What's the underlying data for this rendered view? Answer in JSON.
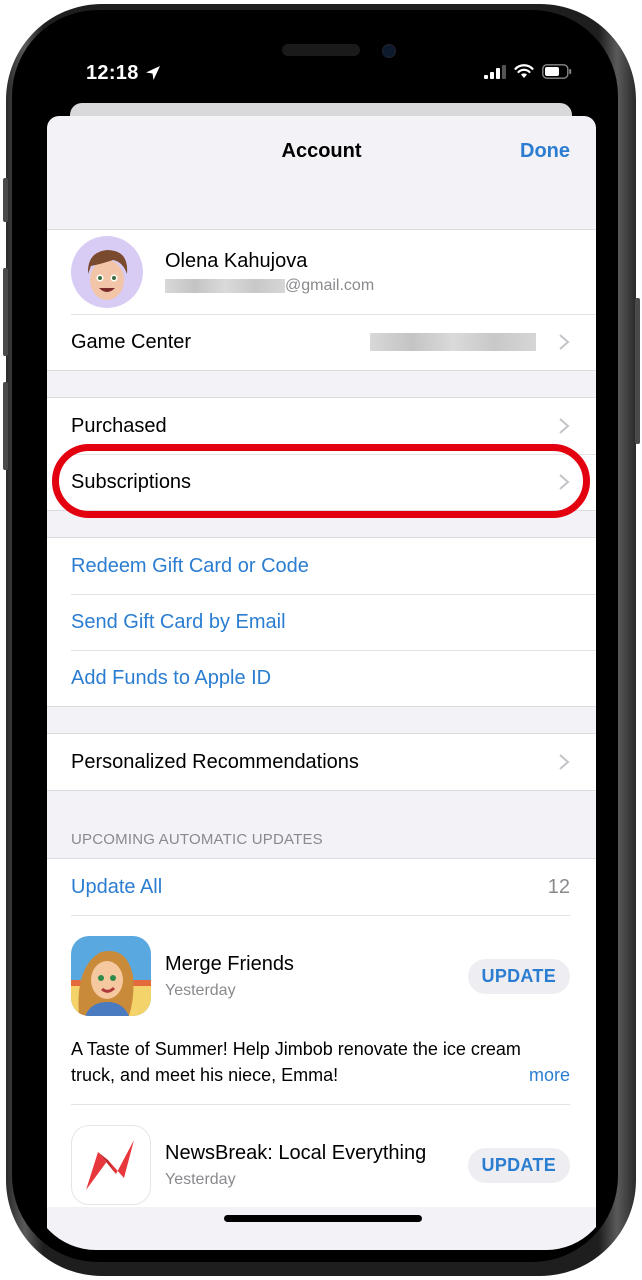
{
  "status_bar": {
    "time": "12:18",
    "location_icon": "location-arrow-icon",
    "signal_icon": "cellular-signal-icon",
    "wifi_icon": "wifi-icon",
    "battery_icon": "battery-icon"
  },
  "nav": {
    "title": "Account",
    "done_label": "Done"
  },
  "profile": {
    "name": "Olena Kahujova",
    "email_visible_suffix": "@gmail.com",
    "avatar_icon": "memoji-avatar-icon"
  },
  "account_rows": [
    {
      "label": "Game Center",
      "value_redacted": true,
      "chevron": true
    }
  ],
  "purchase_rows": [
    {
      "label": "Purchased",
      "chevron": true
    },
    {
      "label": "Subscriptions",
      "chevron": true,
      "highlighted": true
    }
  ],
  "gift_rows": [
    {
      "label": "Redeem Gift Card or Code"
    },
    {
      "label": "Send Gift Card by Email"
    },
    {
      "label": "Add Funds to Apple ID"
    }
  ],
  "prefs_rows": [
    {
      "label": "Personalized Recommendations",
      "chevron": true
    }
  ],
  "updates": {
    "section_header": "UPCOMING AUTOMATIC UPDATES",
    "update_all_label": "Update All",
    "count": "12",
    "apps": [
      {
        "name": "Merge Friends",
        "date": "Yesterday",
        "button_label": "UPDATE",
        "icon": "merge-friends-app-icon",
        "release_notes": "A Taste of Summer! Help Jimbob renovate the ice cream truck, and meet his niece, Emma!",
        "more_label": "more"
      },
      {
        "name": "NewsBreak: Local Everything",
        "date": "Yesterday",
        "button_label": "UPDATE",
        "icon": "newsbreak-app-icon"
      }
    ]
  },
  "colors": {
    "accent": "#2b7dd1",
    "highlight_ring": "#e3000f",
    "grouped_background": "#f2f2f7",
    "secondary_text": "#8a8a8e"
  }
}
